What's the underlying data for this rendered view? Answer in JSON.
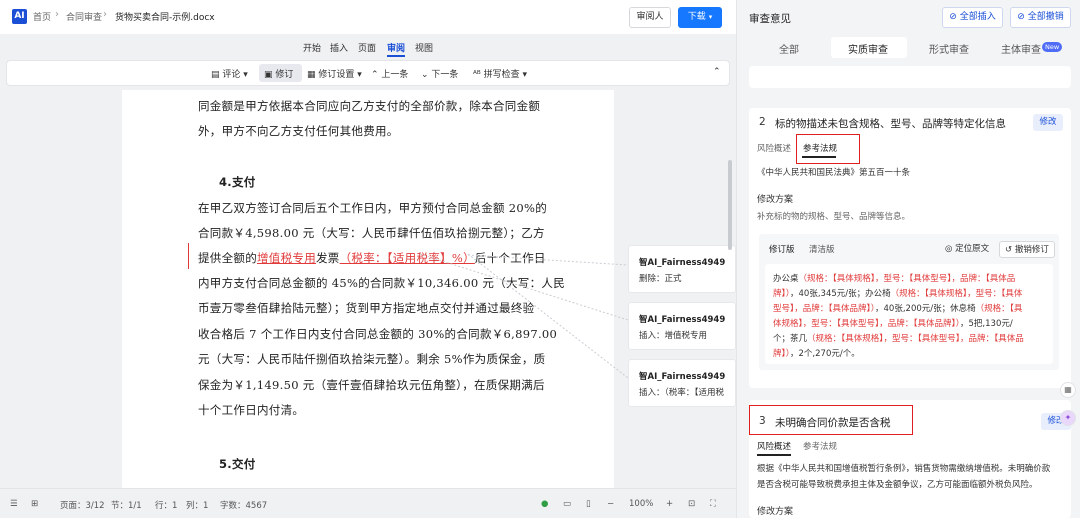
{
  "topbar": {
    "logo": "AI",
    "breadcrumb": [
      "首页",
      "合同审查",
      "货物买卖合同-示例.docx"
    ],
    "reviewer_button": "审阅人",
    "download_button": "下载"
  },
  "menu": {
    "items": [
      "开始",
      "插入",
      "页面",
      "审阅",
      "视图"
    ],
    "active": "审阅"
  },
  "toolbar": {
    "comment": "评论",
    "track": "修订",
    "track_settings": "修订设置",
    "prev": "上一条",
    "next": "下一条",
    "spell": "拼写检查"
  },
  "document": {
    "lines": [
      "同金额是甲方依据本合同应向乙方支付的全部价款，除本合同金额",
      "外，甲方不向乙方支付任何其他费用。",
      "4.支付",
      "在甲乙双方签订合同后五个工作日内，甲方预付合同总金额 20%的",
      "合同款￥4,598.00 元（大写：人民币肆仟伍佰玖拾捌元整）；乙方",
      "内甲方支付合同总金额的 45%的合同款￥10,346.00 元（大写：人民",
      "币壹万零叁佰肆拾陆元整）；货到甲方指定地点交付并通过最终验",
      "收合格后 7 个工作日内支付合同总金额的 30%的合同款￥6,897.00",
      "元（大写：人民币陆仟捌佰玖拾柒元整）。剩余 5%作为质保金，质",
      "保金为￥1,149.50 元（壹仟壹佰肆拾玖元伍角整），在质保期满后",
      "十个工作日内付清。",
      "5.交付"
    ],
    "revised_line": {
      "prefix": "提供全额的",
      "ins1": "增值税专用",
      "mid": "发票",
      "ins2": "（税率：【适用税率】%）",
      "suffix": "后十个工作日"
    }
  },
  "comments": [
    {
      "author": "智AI_Fairness4949",
      "body": "删除：正式"
    },
    {
      "author": "智AI_Fairness4949",
      "body": "插入：增值税专用"
    },
    {
      "author": "智AI_Fairness4949",
      "body": "插入：（税率：【适用税"
    }
  ],
  "statusbar": {
    "page": "页面：3/12",
    "section": "节：1/1",
    "row": "行：1",
    "col": "列：1",
    "words": "字数：4567",
    "zoom": "100%",
    "minus": "−",
    "plus": "+"
  },
  "review": {
    "title": "审查意见",
    "insert_all": "全部插入",
    "revoke_all": "全部撤销",
    "tabs": [
      "全部",
      "实质审查",
      "形式审查",
      "主体审查"
    ],
    "new_badge": "New",
    "card2": {
      "num": "2",
      "title": "标的物描述未包含规格、型号、品牌等特定化信息",
      "edit": "修改",
      "subtabs": [
        "风险概述",
        "参考法规"
      ],
      "law": "《中华人民共和国民法典》第五百一十条",
      "plan_title": "修改方案",
      "plan_desc": "补充标的物的规格、型号、品牌等信息。",
      "box_tabs": [
        "修订版",
        "清洁版"
      ],
      "locate": "定位原文",
      "undo": "撤销修订",
      "box_lines": [
        [
          [
            "办公桌",
            ""
          ],
          [
            "（规格：【具体规格】，型号：【具体型号】，品牌：【具体品",
            "hl"
          ]
        ],
        [
          [
            "牌】）",
            "hl"
          ],
          [
            "，40张,345元/张；办公椅",
            ""
          ],
          [
            "（规格：【具体规格】，型号：【具体",
            "hl"
          ]
        ],
        [
          [
            "型号】，品牌：【具体品牌】）",
            "hl"
          ],
          [
            "，40张,200元/张；休息椅",
            ""
          ],
          [
            "（规格：【具",
            "hl"
          ]
        ],
        [
          [
            "体规格】，型号：【具体型号】，品牌：【具体品牌】）",
            "hl"
          ],
          [
            "，5把,130元/",
            ""
          ]
        ],
        [
          [
            "个；茶几",
            ""
          ],
          [
            "（规格：【具体规格】，型号：【具体型号】，品牌：【具体品",
            "hl"
          ]
        ],
        [
          [
            "牌】）",
            "hl"
          ],
          [
            "，2个,270元/个。",
            ""
          ]
        ]
      ]
    },
    "card3": {
      "num": "3",
      "title": "未明确合同价款是否含税",
      "edit": "修改",
      "subtabs": [
        "风险概述",
        "参考法规"
      ],
      "desc1": "根据《中华人民共和国增值税暂行条例》，销售货物需缴纳增值税。未明确价款",
      "desc2": "是否含税可能导致税费承担主体及金额争议，乙方可能面临额外税负风险。",
      "plan_title": "修改方案"
    }
  }
}
